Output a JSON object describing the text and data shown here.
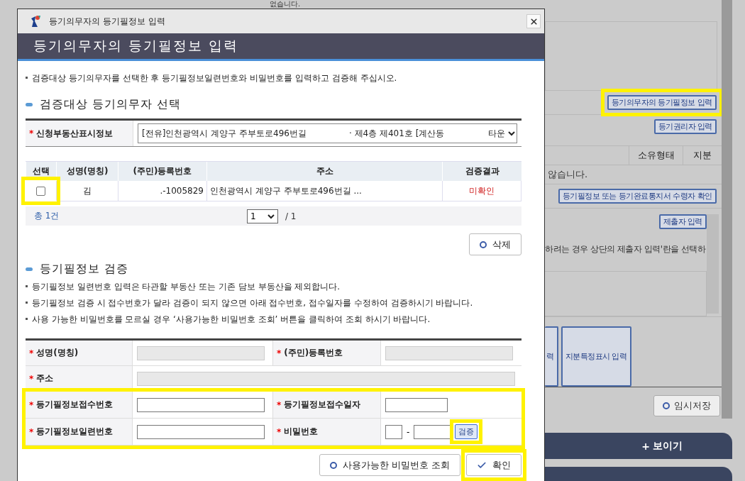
{
  "background": {
    "top_texts": [
      "없습니다."
    ],
    "buttons": [
      {
        "label": "등기의무자의 등기필정보 입력",
        "highlighted": true
      },
      {
        "label": "등기권리자 입력",
        "highlighted": false
      }
    ],
    "table": {
      "columns": [
        "소유형태",
        "지분"
      ],
      "message": "않습니다."
    },
    "receiver_button": "등기필정보 또는 등기완료통지서 수령자 확인",
    "submitter_button": "제출자 입력",
    "submitter_note": "하려는 경우 상단의 제출자 입력'란을 선택하",
    "input_buttons": [
      "력",
      "지분특정표시 입력"
    ],
    "save_button": "임시저장",
    "expand_bar": {
      "icon": "+",
      "label": "보이기"
    }
  },
  "dialog": {
    "title": "등기의무자의 등기필정보 입력",
    "heading": "등기의무자의 등기필정보 입력",
    "intro": "검증대상 등기의무자를 선택한 후 등기필정보일련번호와 비밀번호를 입력하고 검증해 주십시오.",
    "select_section": {
      "title": "검증대상 등기의무자 선택",
      "required_mark": "*",
      "property_label": "신청부동산표시정보",
      "property_value": [
        "[전유]인천광역시 계양구 주부토로496번길",
        "· 제4층 제401호 [계산동",
        "타운"
      ]
    },
    "obligors": {
      "columns": [
        "선택",
        "성명(명칭)",
        "(주민)등록번호",
        "주소",
        "검증결과"
      ],
      "rows": [
        {
          "checked": false,
          "highlighted": true,
          "name": "김",
          "reg_no": ".-1005829",
          "address": "인천광역시 계양구 주부토로496번길",
          "address_more": "...",
          "result": "미확인"
        }
      ],
      "total": "총 1건",
      "page": "1",
      "page_total": "/ 1"
    },
    "delete_button": "삭제",
    "verify_section": {
      "title": "등기필정보 검증",
      "notes": [
        "등기필정보 일련번호 입력은 타관할 부동산 또는 기존 담보 부동산을 제외합니다.",
        "등기필정보 검증 시 접수번호가 달라 검증이 되지 않으면 아래 접수번호, 접수일자를 수정하여 검증하시기 바랍니다.",
        "사용 가능한 비밀번호를 모르실 경우 ‘사용가능한 비밀번호 조회’ 버튼을 클릭하여 조회 하시기 바랍니다."
      ],
      "rows": [
        {
          "highlighted": false,
          "fields": [
            {
              "required_mark": "*",
              "label": "성명(명칭)",
              "kind": "disabled"
            },
            {
              "required_mark": "*",
              "label": "(주민)등록번호",
              "kind": "disabled"
            }
          ]
        },
        {
          "highlighted": false,
          "fields": [
            {
              "required_mark": "*",
              "label": "주소",
              "kind": "wide"
            }
          ]
        },
        {
          "highlighted": true,
          "fields": [
            {
              "required_mark": "*",
              "label": "등기필정보접수번호",
              "kind": "text"
            },
            {
              "required_mark": "*",
              "label": "등기필정보접수일자",
              "kind": "date"
            }
          ]
        },
        {
          "highlighted": true,
          "fields": [
            {
              "required_mark": "*",
              "label": "등기필정보일련번호",
              "kind": "text"
            },
            {
              "required_mark": "*",
              "label": "비밀번호",
              "kind": "password",
              "separator": "-",
              "button": {
                "label": "검증",
                "highlighted": true
              }
            }
          ]
        }
      ]
    },
    "buttons": [
      {
        "label": "사용가능한 비밀번호 조회",
        "kind": "circle",
        "highlighted": false
      },
      {
        "label": "확인",
        "kind": "check",
        "highlighted": true
      }
    ]
  }
}
